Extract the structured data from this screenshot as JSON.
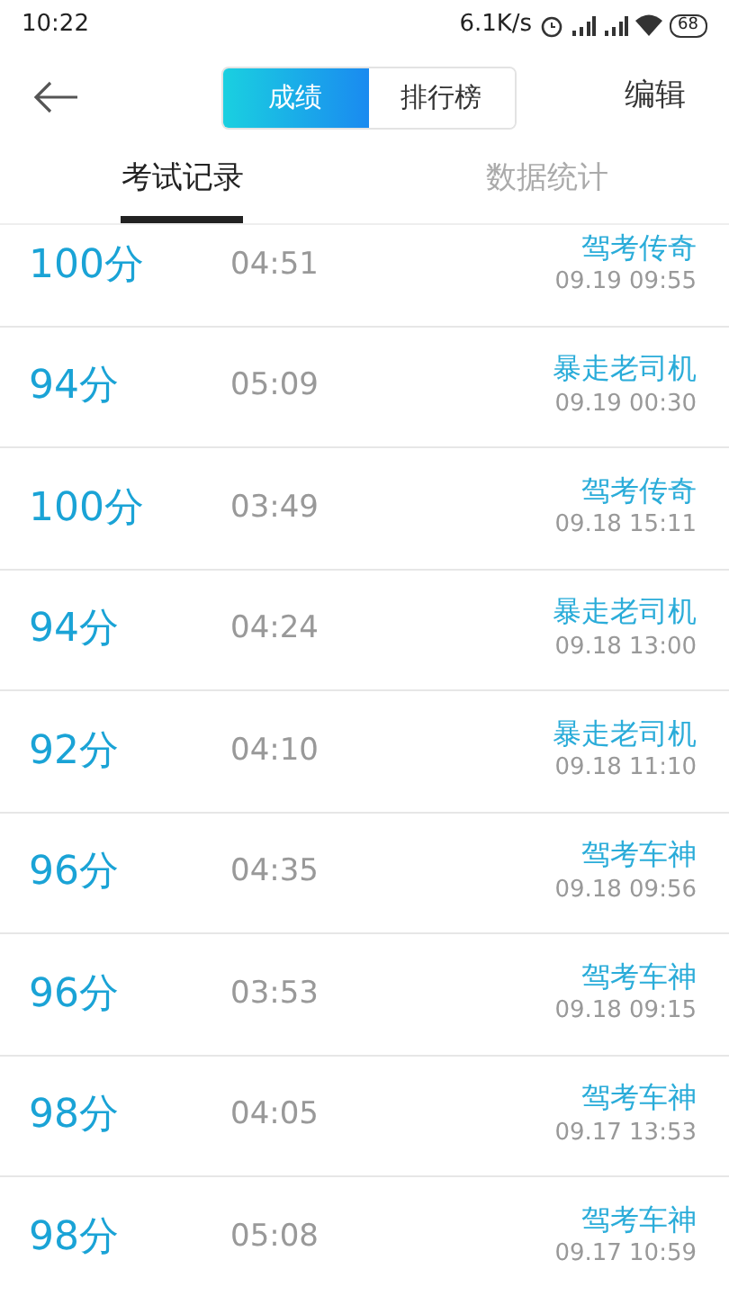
{
  "status_bar": {
    "time": "10:22",
    "speed": "6.1K/s",
    "battery": "68"
  },
  "header": {
    "segments": [
      {
        "label": "成绩",
        "selected": true
      },
      {
        "label": "排行榜",
        "selected": false
      }
    ],
    "action": "编辑"
  },
  "tabs": [
    {
      "label": "考试记录",
      "selected": true
    },
    {
      "label": "数据统计",
      "selected": false
    }
  ],
  "records": [
    {
      "score": "100分",
      "duration": "04:51",
      "title": "驾考传奇",
      "date": "09.19  09:55"
    },
    {
      "score": "94分",
      "duration": "05:09",
      "title": "暴走老司机",
      "date": "09.19  00:30"
    },
    {
      "score": "100分",
      "duration": "03:49",
      "title": "驾考传奇",
      "date": "09.18  15:11"
    },
    {
      "score": "94分",
      "duration": "04:24",
      "title": "暴走老司机",
      "date": "09.18  13:00"
    },
    {
      "score": "92分",
      "duration": "04:10",
      "title": "暴走老司机",
      "date": "09.18  11:10"
    },
    {
      "score": "96分",
      "duration": "04:35",
      "title": "驾考车神",
      "date": "09.18  09:56"
    },
    {
      "score": "96分",
      "duration": "03:53",
      "title": "驾考车神",
      "date": "09.18  09:15"
    },
    {
      "score": "98分",
      "duration": "04:05",
      "title": "驾考车神",
      "date": "09.17  13:53"
    },
    {
      "score": "98分",
      "duration": "05:08",
      "title": "驾考车神",
      "date": "09.17  10:59"
    }
  ]
}
